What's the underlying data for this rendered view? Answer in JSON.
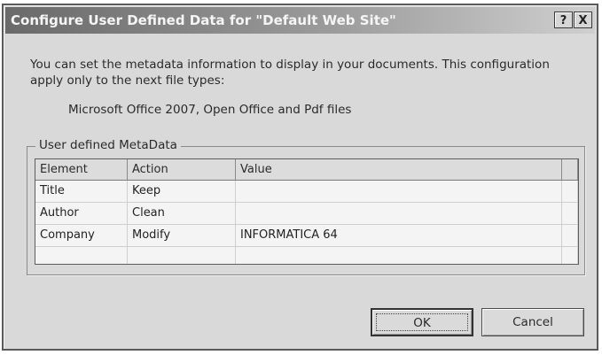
{
  "window": {
    "title": "Configure User Defined Data for \"Default Web Site\"",
    "help_label": "?",
    "close_label": "X"
  },
  "description": "You can set the metadata information to display in your documents. This configuration apply only to the next file types:",
  "file_types": "Microsoft Office 2007, Open Office and Pdf files",
  "group": {
    "label": "User defined MetaData",
    "columns": [
      "Element",
      "Action",
      "Value"
    ],
    "rows": [
      {
        "element": "Title",
        "action": "Keep",
        "value": ""
      },
      {
        "element": "Author",
        "action": "Clean",
        "value": ""
      },
      {
        "element": "Company",
        "action": "Modify",
        "value": "INFORMATICA 64"
      }
    ]
  },
  "buttons": {
    "ok_label": "OK",
    "cancel_label": "Cancel"
  }
}
